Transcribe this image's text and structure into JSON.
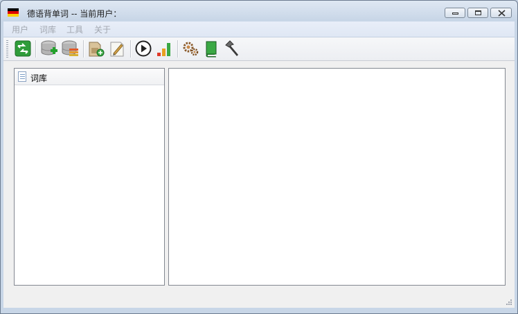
{
  "window": {
    "title": "德语背单词 -- 当前用户：",
    "flag_colors": [
      "#000000",
      "#dd0000",
      "#ffce00"
    ]
  },
  "menu": {
    "items": [
      "用户",
      "词库",
      "工具",
      "关于"
    ]
  },
  "toolbar": {
    "buttons": [
      "exit-icon",
      "add-database-icon",
      "database-list-icon",
      "add-package-icon",
      "edit-note-icon",
      "play-icon",
      "signal-bars-icon",
      "settings-gears-icon",
      "green-book-icon",
      "hammer-icon"
    ]
  },
  "tree": {
    "header_label": "词库"
  },
  "colors": {
    "menu_disabled_text": "#a2a7b0",
    "client_background": "#f0f0f0",
    "panel_border": "#828790"
  }
}
